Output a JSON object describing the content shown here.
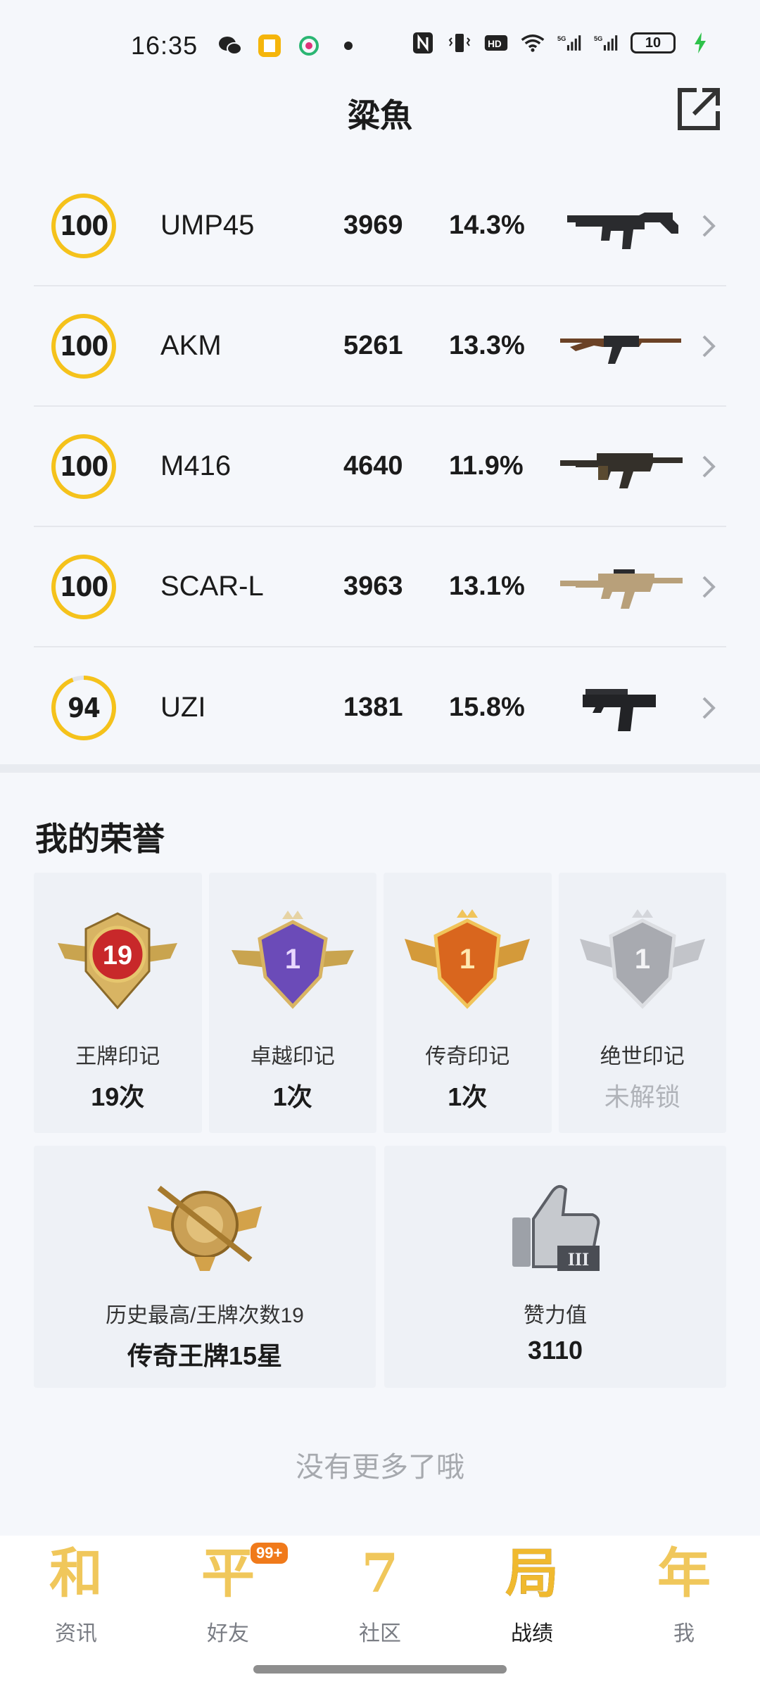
{
  "status": {
    "time": "16:35",
    "battery": "10",
    "icons_left": [
      "wechat-icon",
      "book-app-icon",
      "china-mobile-icon",
      "dot-icon"
    ],
    "icons_right": [
      "nfc-icon",
      "vibrate-icon",
      "hd-icon",
      "wifi-icon",
      "5g-signal-icon",
      "5g-signal-icon",
      "battery-icon",
      "charging-icon"
    ]
  },
  "header": {
    "title": "粱魚"
  },
  "weapons": [
    {
      "ring": "100",
      "progress": 1.0,
      "name": "UMP45",
      "kills": "3969",
      "rate": "14.3%"
    },
    {
      "ring": "100",
      "progress": 1.0,
      "name": "AKM",
      "kills": "5261",
      "rate": "13.3%"
    },
    {
      "ring": "100",
      "progress": 1.0,
      "name": "M416",
      "kills": "4640",
      "rate": "11.9%"
    },
    {
      "ring": "100",
      "progress": 1.0,
      "name": "SCAR-L",
      "kills": "3963",
      "rate": "13.1%"
    },
    {
      "ring": "94",
      "progress": 0.94,
      "name": "UZI",
      "kills": "1381",
      "rate": "15.8%"
    }
  ],
  "honors": {
    "title": "我的荣誉",
    "cards": [
      {
        "badge_number": "19",
        "name": "王牌印记",
        "count": "19次",
        "locked": false,
        "color": "#c8282a"
      },
      {
        "badge_number": "1",
        "name": "卓越印记",
        "count": "1次",
        "locked": false,
        "color": "#6b4bb8"
      },
      {
        "badge_number": "1",
        "name": "传奇印记",
        "count": "1次",
        "locked": false,
        "color": "#d9661e"
      },
      {
        "badge_number": "1",
        "name": "绝世印记",
        "count": "未解锁",
        "locked": true,
        "color": "#a8aab0"
      }
    ],
    "stats": [
      {
        "label": "历史最高/王牌次数19",
        "value": "传奇王牌15星"
      },
      {
        "label": "赞力值",
        "value": "3110"
      }
    ]
  },
  "footer_note": "没有更多了哦",
  "nav": [
    {
      "glyph": "和",
      "label": "资讯",
      "active": false
    },
    {
      "glyph": "平",
      "label": "好友",
      "active": false,
      "badge": "99+"
    },
    {
      "glyph": "7",
      "label": "社区",
      "active": false
    },
    {
      "glyph": "局",
      "label": "战绩",
      "active": true
    },
    {
      "glyph": "年",
      "label": "我",
      "active": false
    }
  ],
  "colors": {
    "accent": "#f5c21b",
    "ring_track": "#e3e5ea",
    "badge": "#f07a1b"
  }
}
